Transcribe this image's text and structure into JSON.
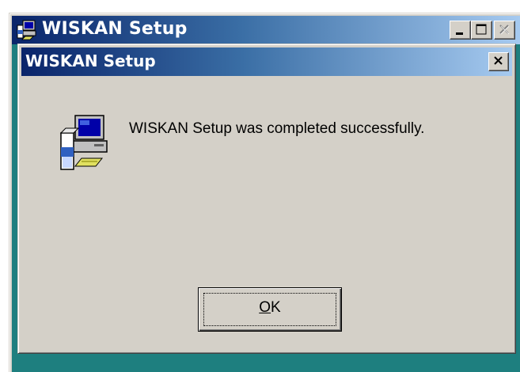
{
  "outer_window": {
    "title": "WISKAN Setup",
    "caption_buttons": {
      "minimize_icon": "minimize-icon",
      "maximize_icon": "maximize-icon",
      "close_icon": "close-icon",
      "close_enabled": false
    },
    "background_color": "#1e7f7f"
  },
  "dialog": {
    "title": "WISKAN Setup",
    "close_icon": "close-icon",
    "icon": "setup-computer-icon",
    "message": "WISKAN Setup was completed successfully.",
    "ok_button": {
      "mnemonic": "O",
      "rest": "K",
      "focused": true
    }
  },
  "colors": {
    "titlebar_start": "#0a246a",
    "titlebar_end": "#a6caf0",
    "face": "#d4d0c8"
  }
}
